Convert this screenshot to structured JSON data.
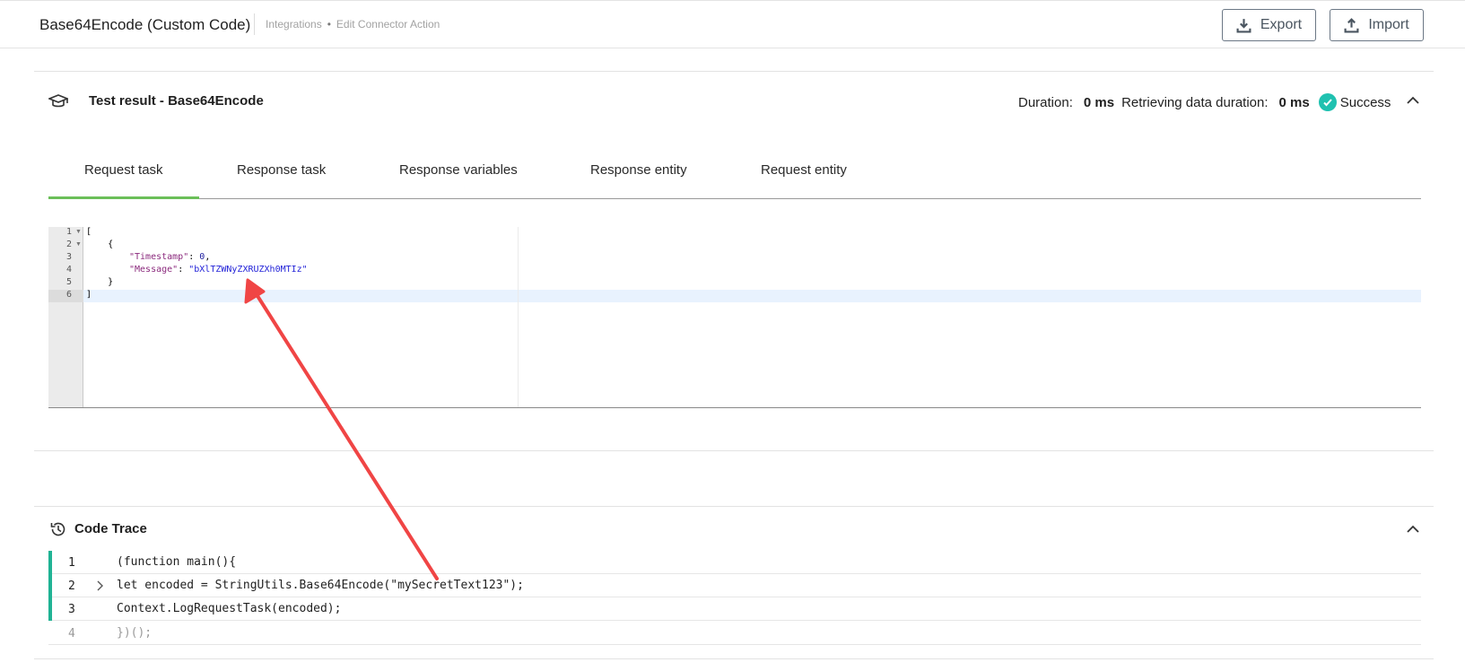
{
  "header": {
    "title": "Base64Encode (Custom Code)",
    "breadcrumb": [
      "Integrations",
      "Edit Connector Action"
    ],
    "breadcrumb_sep": "•",
    "export_label": "Export",
    "import_label": "Import"
  },
  "test_result": {
    "title": "Test result - Base64Encode",
    "duration_label": "Duration:",
    "duration_value": "0 ms",
    "retrieving_label": "Retrieving data duration:",
    "retrieving_value": "0 ms",
    "status": "Success",
    "status_color": "#1fc1b0"
  },
  "tabs": [
    {
      "label": "Request task",
      "active": true
    },
    {
      "label": "Response task"
    },
    {
      "label": "Response variables"
    },
    {
      "label": "Response entity"
    },
    {
      "label": "Request entity"
    }
  ],
  "accent_color": "#6bbf59",
  "editor": {
    "line_numbers": [
      "1",
      "2",
      "3",
      "4",
      "5",
      "6"
    ],
    "lines": {
      "l1": "[",
      "l2": "    {",
      "l3_key": "\"Timestamp\"",
      "l3_sep": ": ",
      "l3_val": "0",
      "l3_end": ",",
      "l4_key": "\"Message\"",
      "l4_sep": ": ",
      "l4_val": "\"bXlTZWNyZXRUZXh0MTIz\"",
      "l5": "    }",
      "l6": "]"
    }
  },
  "code_trace": {
    "title": "Code Trace",
    "rows": [
      {
        "num": "1",
        "code": "(function main(){"
      },
      {
        "num": "2",
        "code": "let encoded = StringUtils.Base64Encode(\"mySecretText123\");"
      },
      {
        "num": "3",
        "code": "Context.LogRequestTask(encoded);"
      },
      {
        "num": "4",
        "code": "})();"
      }
    ],
    "bar_color": "#20b394"
  },
  "annotation": {
    "arrow_color": "#f04545"
  }
}
